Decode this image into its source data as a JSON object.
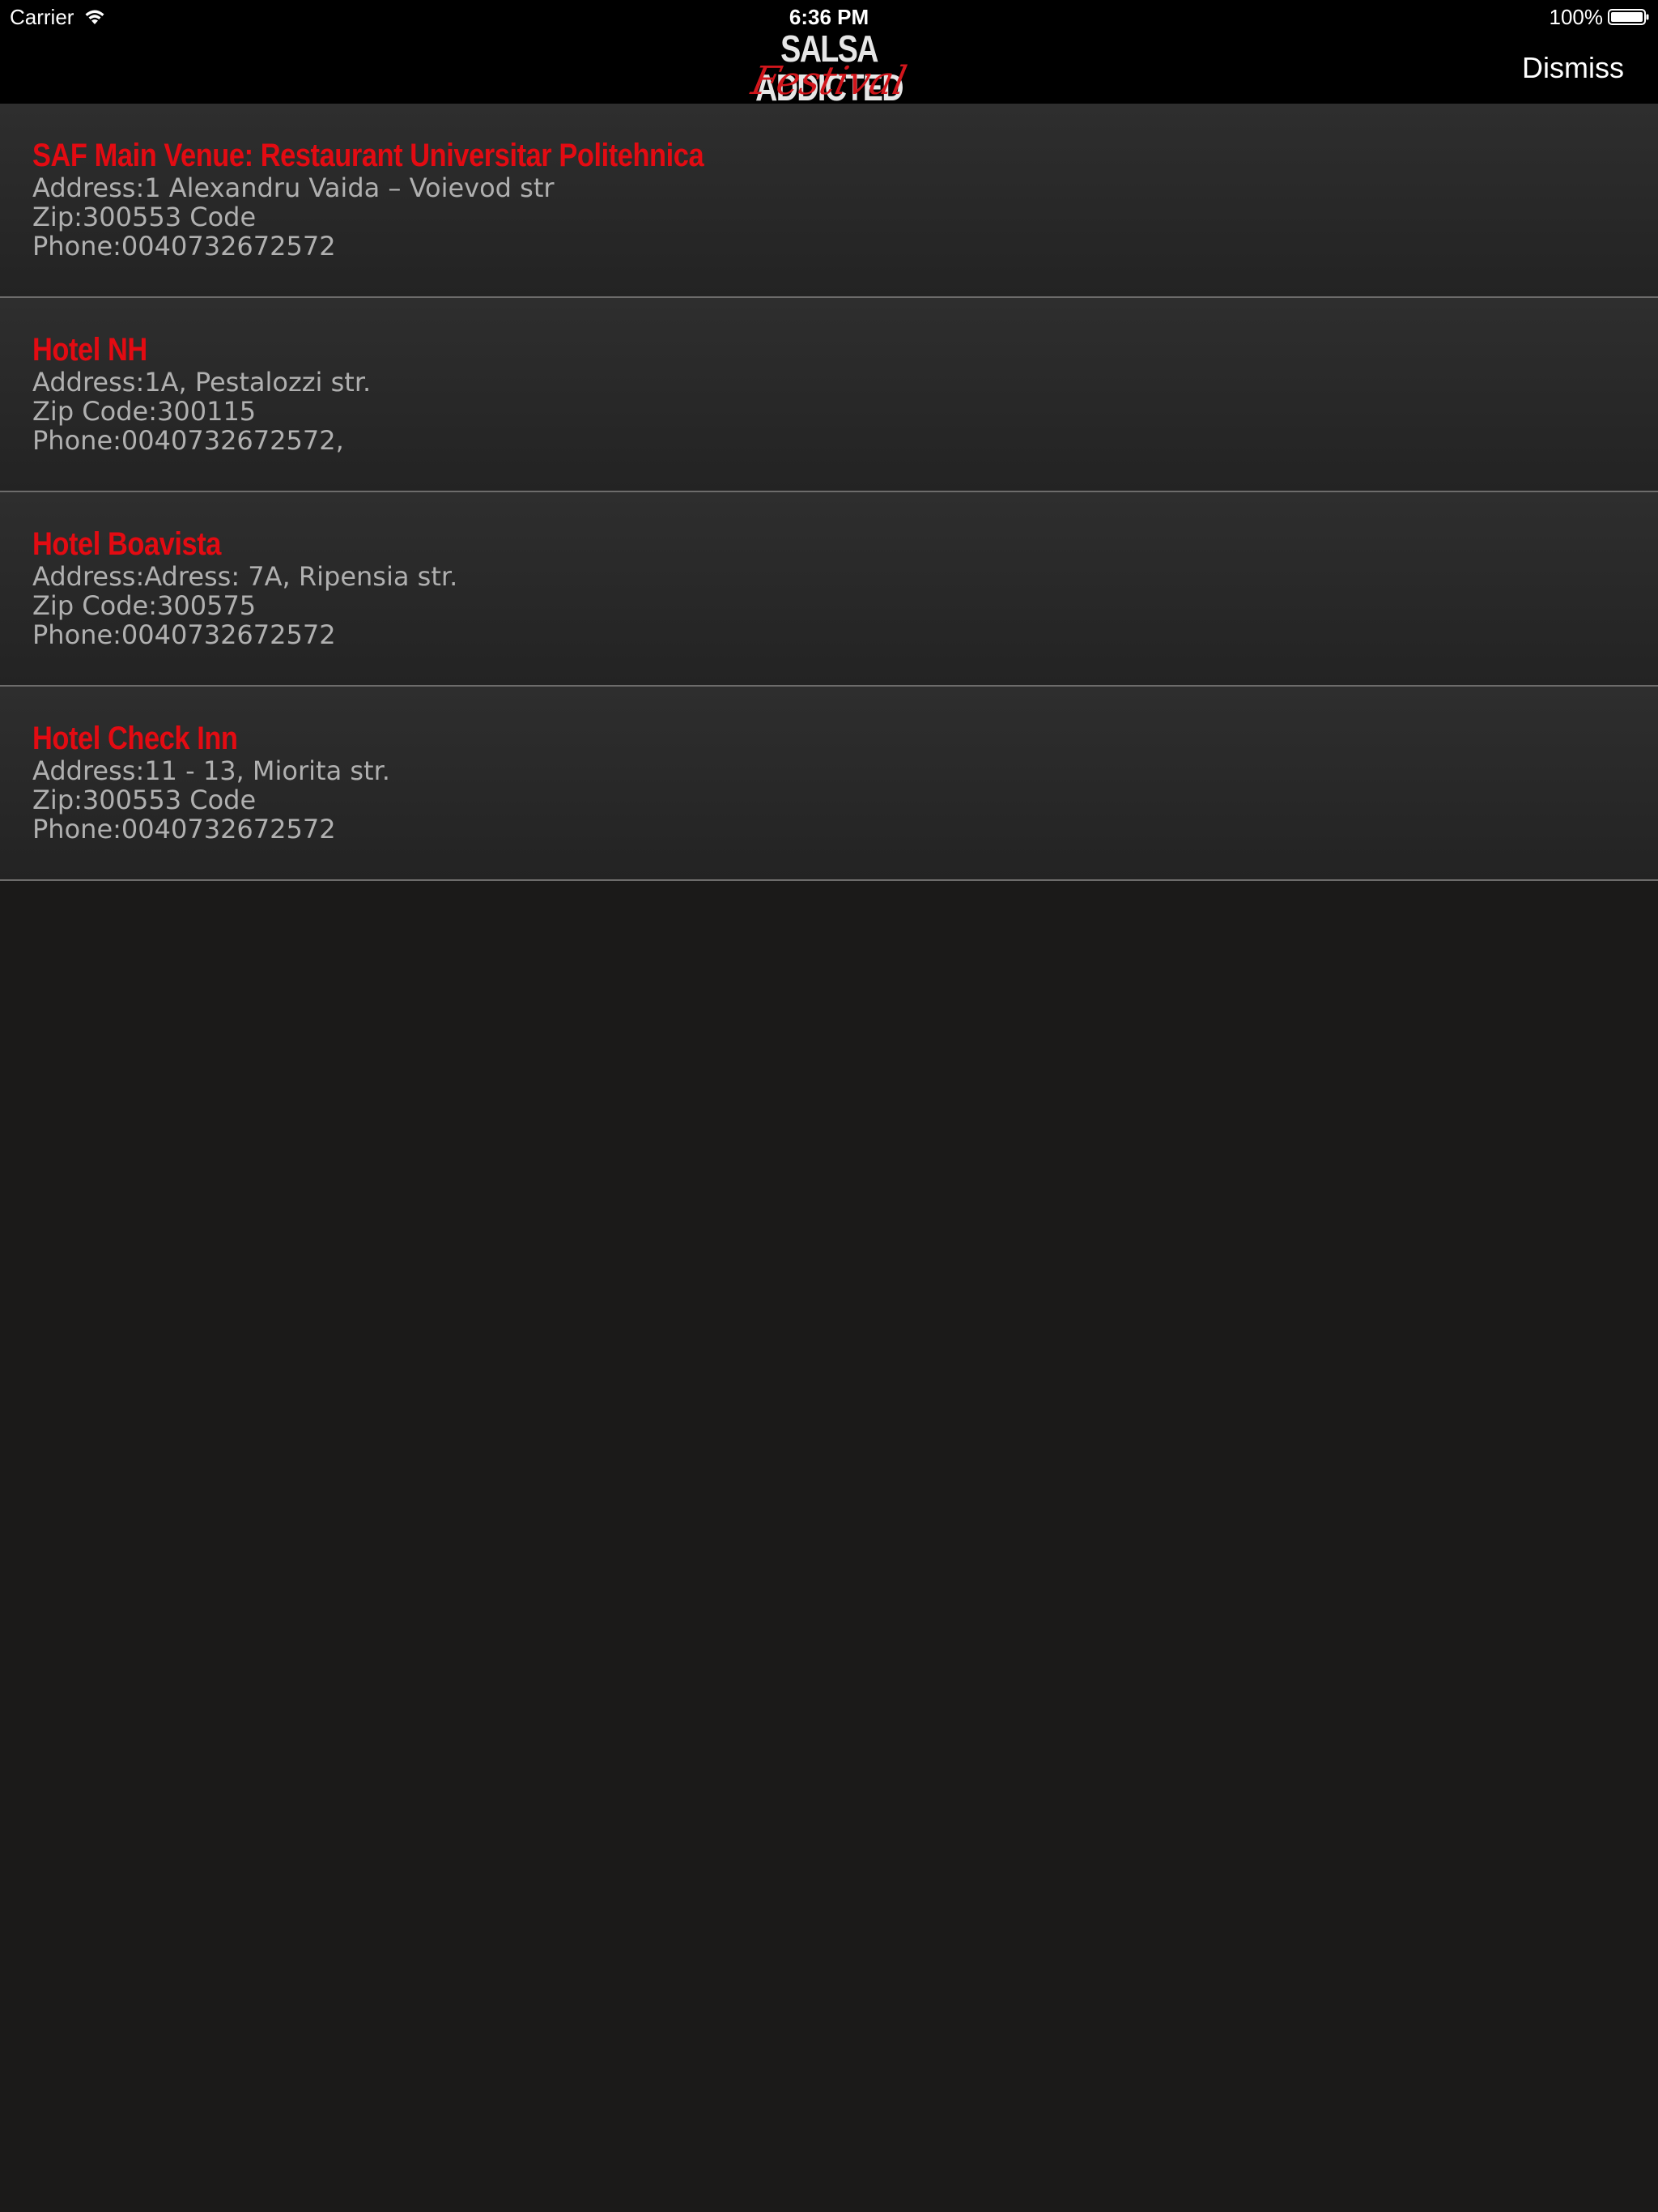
{
  "status_bar": {
    "carrier": "Carrier",
    "time": "6:36 PM",
    "battery": "100%"
  },
  "nav": {
    "logo_top": "SALSA ADDICTED",
    "logo_bottom": "Festival",
    "dismiss_label": "Dismiss"
  },
  "colors": {
    "accent_red": "#e30b12",
    "background": "#1b1a19",
    "text_gray": "#b0b0b0"
  },
  "venues": [
    {
      "name": "SAF Main Venue: Restaurant Universitar Politehnica",
      "address": "Address:1 Alexandru Vaida – Voievod str",
      "zip": "Zip:300553 Code",
      "phone": "Phone:0040732672572"
    },
    {
      "name": "Hotel NH",
      "address": "Address:1A, Pestalozzi str.",
      "zip": "Zip Code:300115",
      "phone": "Phone:0040732672572,"
    },
    {
      "name": "Hotel Boavista",
      "address": "Address:Adress: 7A, Ripensia str.",
      "zip": "Zip Code:300575",
      "phone": "Phone:0040732672572"
    },
    {
      "name": "Hotel Check Inn",
      "address": "Address:11 - 13, Miorita str.",
      "zip": "Zip:300553 Code",
      "phone": "Phone:0040732672572"
    }
  ]
}
